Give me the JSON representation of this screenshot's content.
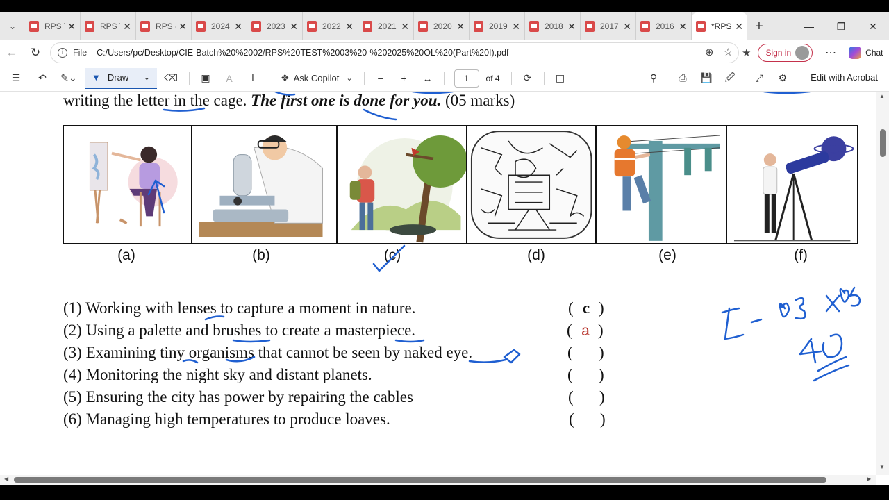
{
  "tabs": [
    {
      "label": "RPS T"
    },
    {
      "label": "RPS T"
    },
    {
      "label": "RPS -"
    },
    {
      "label": "2024"
    },
    {
      "label": "2023"
    },
    {
      "label": "2022"
    },
    {
      "label": "2021"
    },
    {
      "label": "2020"
    },
    {
      "label": "2019"
    },
    {
      "label": "2018"
    },
    {
      "label": "2017"
    },
    {
      "label": "2016"
    }
  ],
  "active_tab": {
    "label": "*RPS"
  },
  "address": {
    "scheme_label": "File",
    "url": "C:/Users/pc/Desktop/CIE-Batch%20%2002/RPS%20TEST%2003%20-%202025%20OL%20(Part%20I).pdf"
  },
  "profile": {
    "signin_label": "Sign in",
    "chat_label": "Chat"
  },
  "pdf_toolbar": {
    "draw_label": "Draw",
    "ask_copilot_label": "Ask Copilot",
    "page_current": "1",
    "page_total": "of 4",
    "edit_acrobat_label": "Edit with Acrobat"
  },
  "document": {
    "instruction_start": "writing the letter in the cage. ",
    "instruction_emph": "The first one is done for you.",
    "instruction_end": " (05 marks)",
    "captions": [
      "(a)",
      "(b)",
      "(c)",
      "(d)",
      "(e)",
      "(f)"
    ],
    "questions": [
      {
        "text": "(1) Working with lenses to capture a moment in nature.",
        "answer": "c"
      },
      {
        "text": "(2) Using a palette and brushes to create a masterpiece.",
        "answer": "a"
      },
      {
        "text": "(3) Examining tiny organisms that cannot be seen by naked eye.",
        "answer": ""
      },
      {
        "text": "(4) Monitoring the night sky and distant planets.",
        "answer": ""
      },
      {
        "text": "(5) Ensuring the city has power by repairing the cables",
        "answer": ""
      },
      {
        "text": "(6) Managing high temperatures to produce loaves.",
        "answer": ""
      }
    ],
    "paren_open": "(",
    "paren_close": ")"
  },
  "colors": {
    "ink": "#1f5fd1",
    "answer_red": "#b3261e",
    "accent": "#1a56b0"
  }
}
